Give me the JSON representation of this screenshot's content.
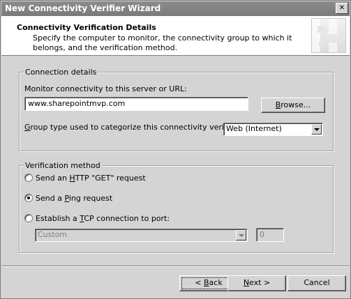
{
  "window": {
    "title": "New Connectivity Verifier Wizard",
    "close_glyph": "✕"
  },
  "header": {
    "title": "Connectivity Verification Details",
    "description": "Specify the computer to monitor, the connectivity group to which it belongs, and the verification method."
  },
  "connection": {
    "group_label": "Connection details",
    "monitor_label": "Monitor connectivity to this server or URL:",
    "monitor_value": "www.sharepointmvp.com",
    "browse_label": "Browse...",
    "group_type_label": "Group type used to categorize this connectivity verifier:",
    "group_type_value": "Web (Internet)"
  },
  "verification": {
    "group_label": "Verification method",
    "options": [
      {
        "label": "Send an HTTP \"GET\" request",
        "checked": false
      },
      {
        "label": "Send a Ping request",
        "checked": true
      },
      {
        "label": "Establish a TCP connection to port:",
        "checked": false
      }
    ],
    "port_type_value": "Custom",
    "port_number_value": "0"
  },
  "footer": {
    "back_label": "< Back",
    "next_label": "Next >",
    "cancel_label": "Cancel"
  }
}
